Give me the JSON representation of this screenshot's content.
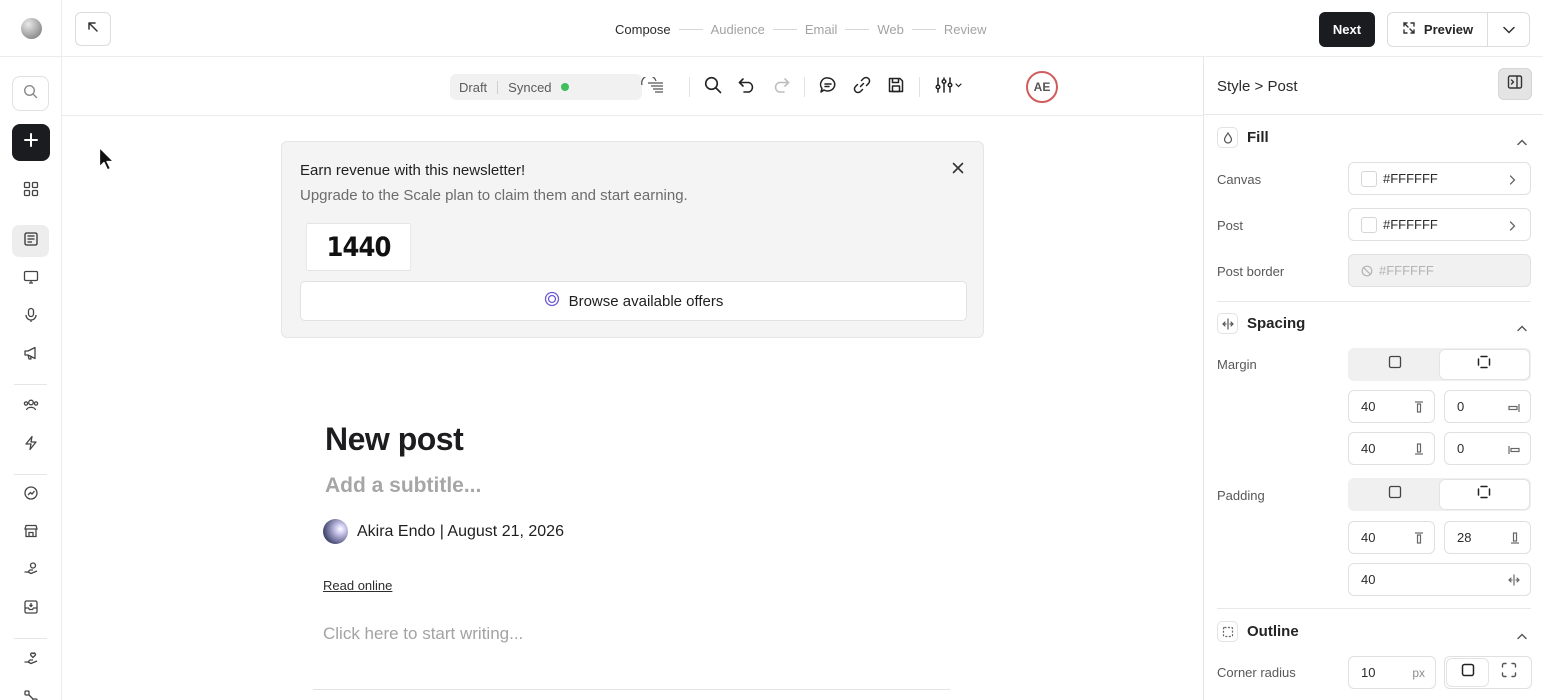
{
  "topbar": {
    "steps": [
      {
        "label": "Compose",
        "active": true
      },
      {
        "label": "Audience",
        "active": false
      },
      {
        "label": "Email",
        "active": false
      },
      {
        "label": "Web",
        "active": false
      },
      {
        "label": "Review",
        "active": false
      }
    ],
    "next_label": "Next",
    "preview_label": "Preview"
  },
  "toolbar": {
    "status": {
      "draft": "Draft",
      "synced": "Synced",
      "synced_color": "#3fbf5a"
    },
    "avatar_initials": "AE",
    "avatar_ring_color": "#d25c5c"
  },
  "banner": {
    "title": "Earn revenue with this newsletter!",
    "subtitle": "Upgrade to the Scale plan to claim them and start earning.",
    "logo_text": "1440",
    "offers_label": "Browse available offers"
  },
  "post": {
    "title": "New post",
    "subtitle_placeholder": "Add a subtitle...",
    "byline": "Akira Endo | August 21, 2026",
    "read_online": "Read online",
    "body_placeholder": "Click here to start writing..."
  },
  "panel": {
    "breadcrumb_parent": "Style",
    "breadcrumb_sep": ">",
    "breadcrumb_current": "Post",
    "fill": {
      "title": "Fill",
      "canvas_label": "Canvas",
      "canvas_value": "#FFFFFF",
      "post_label": "Post",
      "post_value": "#FFFFFF",
      "border_label": "Post border",
      "border_value": "#FFFFFF"
    },
    "spacing": {
      "title": "Spacing",
      "margin_label": "Margin",
      "margin_top": "40",
      "margin_right": "0",
      "margin_bottom": "40",
      "margin_left": "0",
      "padding_label": "Padding",
      "padding_top": "40",
      "padding_bottom": "28",
      "padding_horizontal": "40"
    },
    "outline": {
      "title": "Outline",
      "corner_label": "Corner radius",
      "corner_value": "10",
      "corner_unit": "px"
    }
  }
}
